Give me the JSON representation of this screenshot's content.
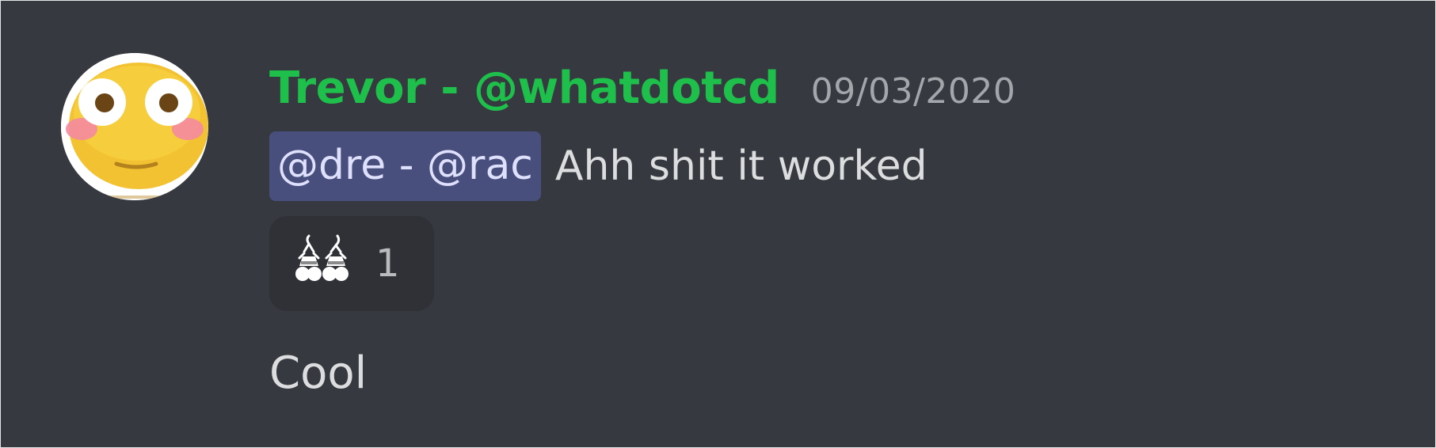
{
  "message": {
    "author": {
      "display_name": "Trevor - @whatdotcd",
      "avatar_icon": "flushed-face-emoji",
      "name_color": "#1fbf4b"
    },
    "timestamp": "09/03/2020",
    "mention": "@dre - @rac",
    "text": "Ahh shit it worked",
    "reactions": [
      {
        "emoji": "dancing-cherries-emoji",
        "count": "1"
      }
    ]
  },
  "followup_message": {
    "text": "Cool"
  },
  "colors": {
    "background": "#36393f",
    "mention_bg": "#484f7c",
    "mention_text": "#dee0fc",
    "reaction_bg": "#2f3136"
  }
}
